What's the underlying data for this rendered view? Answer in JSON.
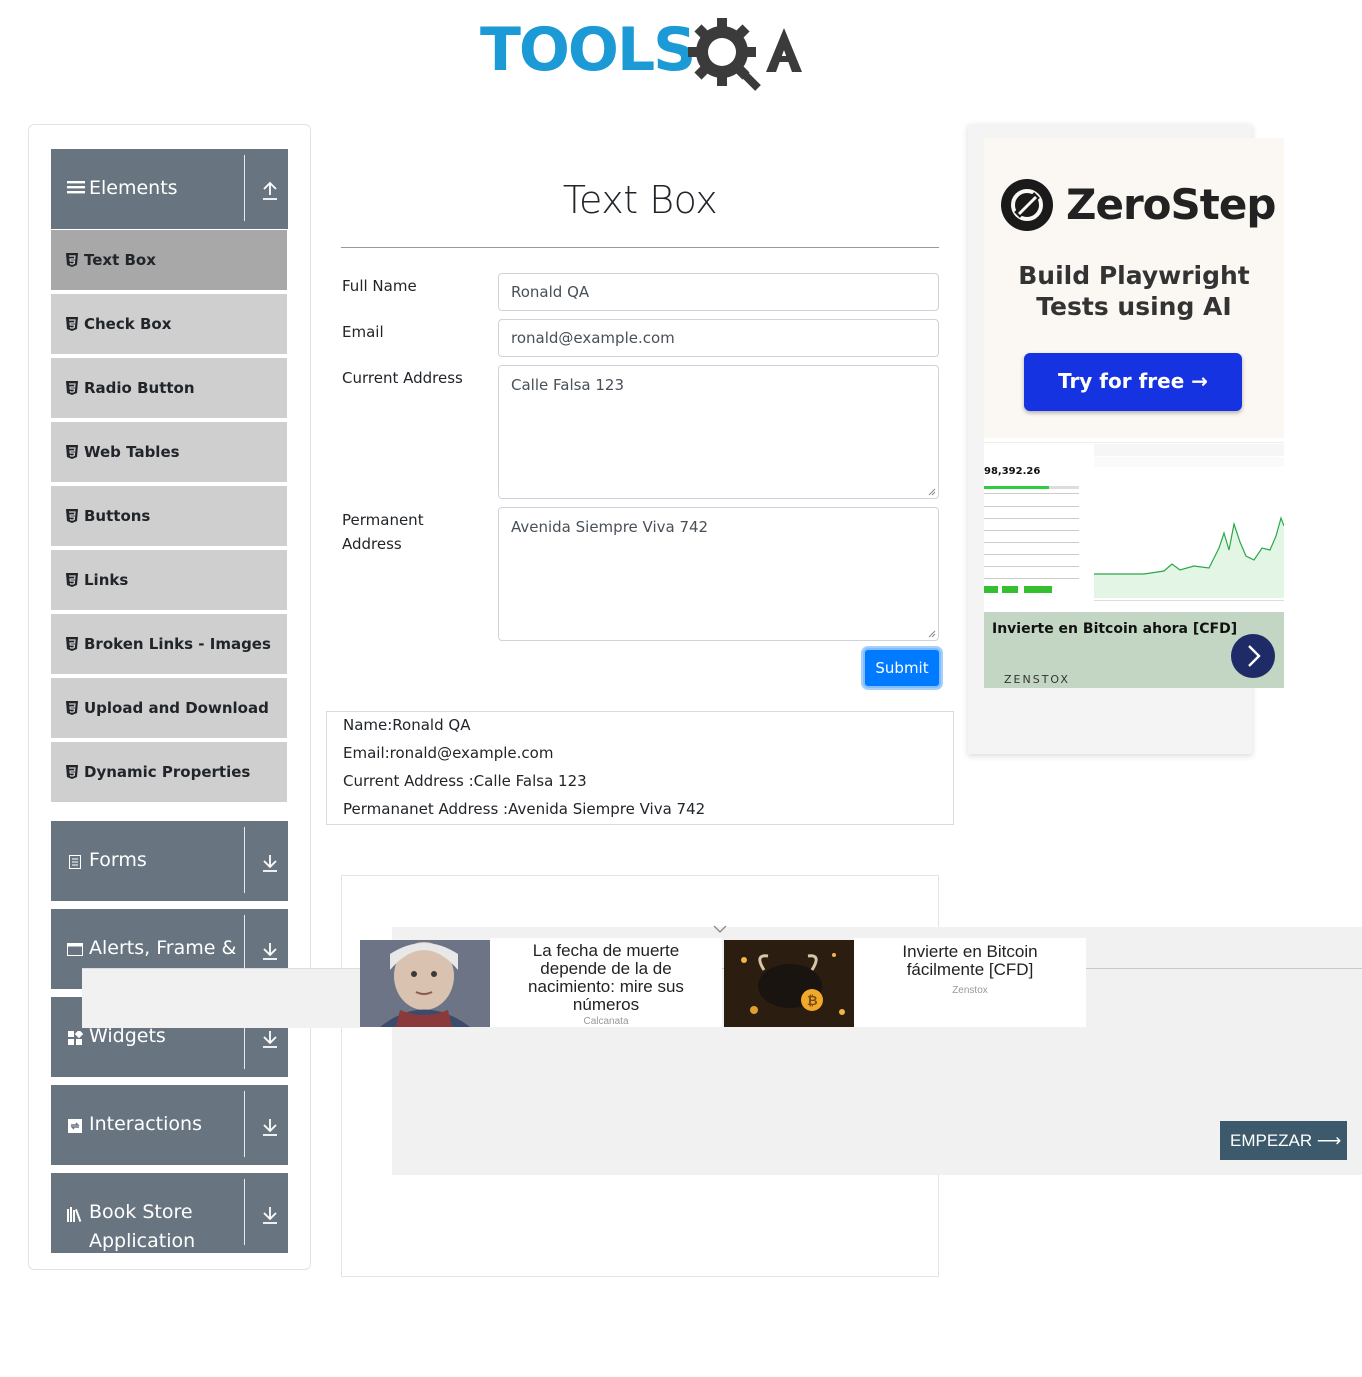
{
  "logo": {
    "text": "TOOLS",
    "text2": "QA"
  },
  "sidebar": {
    "groups": [
      {
        "label": "Elements",
        "icon": "hamburger-icon",
        "arrow": "collapse-up-icon"
      },
      {
        "label": "Forms",
        "icon": "document-icon",
        "arrow": "expand-down-icon"
      },
      {
        "label": "Alerts, Frame &",
        "icon": "window-icon",
        "arrow": "expand-down-icon"
      },
      {
        "label": "Widgets",
        "icon": "widgets-icon",
        "arrow": "expand-down-icon"
      },
      {
        "label": "Interactions",
        "icon": "interactions-icon",
        "arrow": "expand-down-icon"
      },
      {
        "label": "Book Store",
        "label2": "Application",
        "icon": "books-icon",
        "arrow": "expand-down-icon"
      }
    ],
    "items": [
      {
        "label": "Text Box",
        "active": true
      },
      {
        "label": "Check Box"
      },
      {
        "label": "Radio Button"
      },
      {
        "label": "Web Tables"
      },
      {
        "label": "Buttons"
      },
      {
        "label": "Links"
      },
      {
        "label": "Broken Links - Images"
      },
      {
        "label": "Upload and Download"
      },
      {
        "label": "Dynamic Properties"
      }
    ]
  },
  "main": {
    "title": "Text Box",
    "labels": {
      "full_name": "Full Name",
      "email": "Email",
      "current_address": "Current Address",
      "permanent_address_1": "Permanent",
      "permanent_address_2": "Address"
    },
    "values": {
      "full_name": "Ronald QA",
      "email": "ronald@example.com",
      "current_address": "Calle Falsa 123",
      "permanent_address": "Avenida Siempre Viva 742"
    },
    "submit_label": "Submit"
  },
  "output": {
    "name": "Name:Ronald QA",
    "email": "Email:ronald@example.com",
    "current_address": "Current Address :Calle Falsa 123",
    "permanent_address": "Permananet Address :Avenida Siempre Viva 742"
  },
  "right_ad": {
    "brand": "ZeroStep",
    "tagline_1": "Build Playwright",
    "tagline_2": "Tests using AI",
    "cta": "Try for free →",
    "btc_price": "98,392.26",
    "btc_title": "Invierte en Bitcoin ahora [CFD]",
    "btc_brand": "ZENSTOX"
  },
  "bottom_ad": {
    "card1_headline": "La fecha de muerte depende de la de nacimiento: mire sus números",
    "card1_source": "Calcanata",
    "card2_headline": "Invierte en Bitcoin fácilmente [CFD]",
    "card2_source": "Zenstox",
    "cta": "EMPEZAR ⟶"
  },
  "colors": {
    "brand_blue": "#1b9ad6",
    "sidebar_header": "#687580",
    "menu_item": "#cfcfcf",
    "menu_item_active": "#a8a8a8",
    "submit": "#007bff",
    "zerostep_cta": "#1533e0",
    "empezar": "#3d5a6c"
  }
}
